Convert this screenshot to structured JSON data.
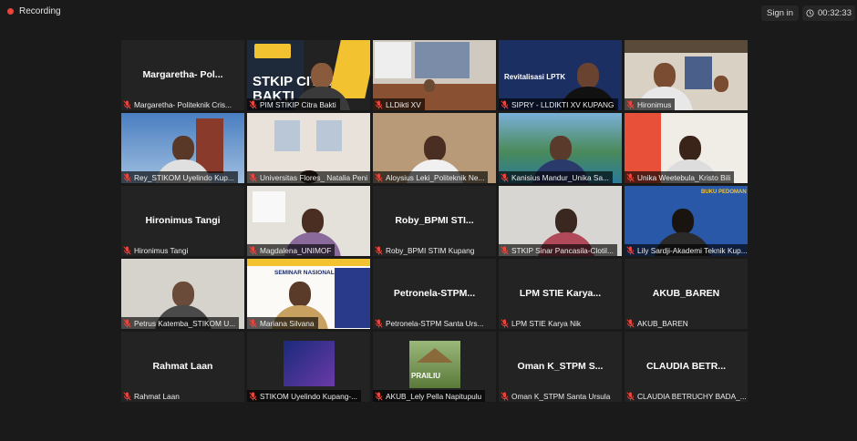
{
  "topbar": {
    "recording_label": "Recording",
    "signin_label": "Sign in",
    "timer": "00:32:33",
    "colors": {
      "recording_dot": "#e8453c"
    }
  },
  "participants": [
    {
      "name": "Margaretha- Politeknik Cris...",
      "display_name": "Margaretha-  Pol..."
    },
    {
      "name": "PIM STIKIP Citra Bakti",
      "slide_text": "STKIP CITRA BAKTI"
    },
    {
      "name": "LLDikti XV"
    },
    {
      "name": "SIPRY - LLDIKTI XV KUPANG",
      "slide_text": "Revitalisasi LPTK"
    },
    {
      "name": "Hironimus"
    },
    {
      "name": "Rey_STIKOM Uyelindo Kup..."
    },
    {
      "name": "Universitas Flores_ Natalia Peni"
    },
    {
      "name": "Aloysius Leki_Politeknik Ne..."
    },
    {
      "name": "Kanisius Mandur_Unika Sa..."
    },
    {
      "name": "Unika Weetebula_Kristo Bili"
    },
    {
      "name": "Hironimus Tangi",
      "display_name": "Hironimus Tangi"
    },
    {
      "name": "Magdalena_UNIMOF"
    },
    {
      "name": "Roby_BPMI STIM Kupang",
      "display_name": "Roby_BPMI  STI..."
    },
    {
      "name": "STKIP Sinar Pancasila-Clotil..."
    },
    {
      "name": "Lily Sardji-Akademi Teknik Kup...",
      "slide_text": "BUKU PEDOMAN"
    },
    {
      "name": "Petrus Katemba_STIKOM U..."
    },
    {
      "name": "Mariana Silvana",
      "slide_text": "SEMINAR NASIONAL"
    },
    {
      "name": "Petronela-STPM Santa Urs...",
      "display_name": "Petronela-STPM..."
    },
    {
      "name": "LPM STIE Karya Nik",
      "display_name": "LPM STIE Karya..."
    },
    {
      "name": "AKUB_BAREN",
      "display_name": "AKUB_BAREN"
    },
    {
      "name": "Rahmat Laan",
      "display_name": "Rahmat Laan"
    },
    {
      "name": "STIKOM Uyelindo Kupang-..."
    },
    {
      "name": "AKUB_Lely Pella Napitupulu",
      "slide_text": "PRAILIU"
    },
    {
      "name": "Oman K_STPM Santa Ursula",
      "display_name": "Oman K_STPM  S..."
    },
    {
      "name": "CLAUDIA BETRUCHY BADA_...",
      "display_name": "CLAUDIA  BETR..."
    }
  ]
}
